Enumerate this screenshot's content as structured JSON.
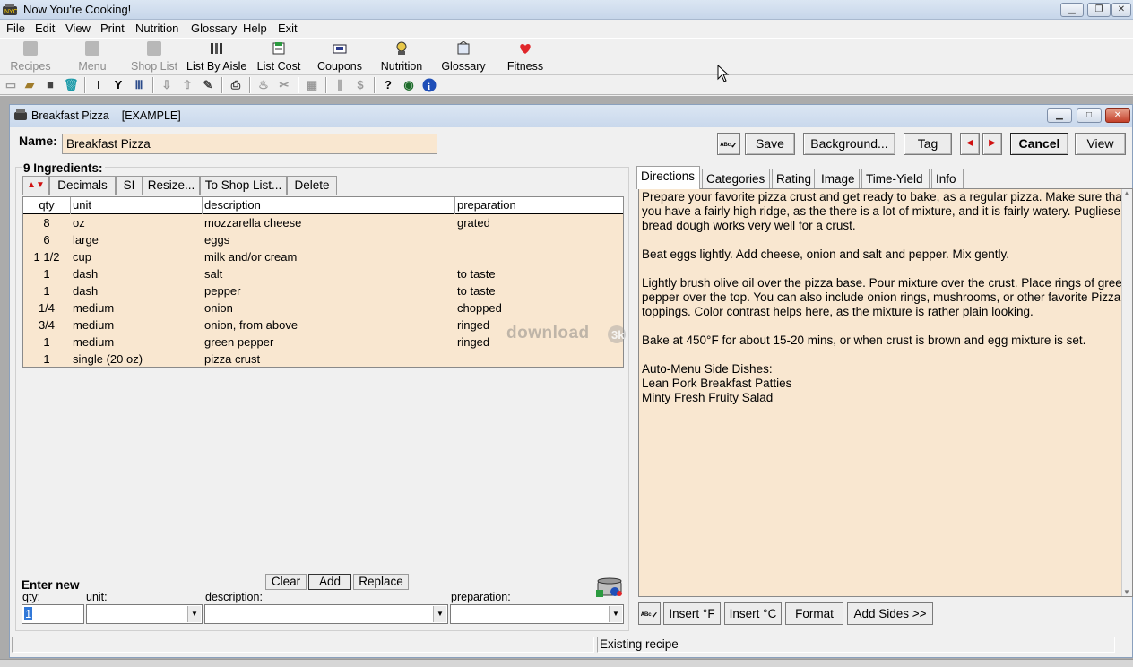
{
  "window": {
    "title": "Now You're Cooking!"
  },
  "menu": [
    "File",
    "Edit",
    "View",
    "Print",
    "Nutrition",
    "Glossary",
    "Help",
    "Exit"
  ],
  "big_toolbar": [
    {
      "label": "Recipes",
      "icon": "recipes-icon",
      "enabled": false
    },
    {
      "label": "Menu",
      "icon": "menu-icon",
      "enabled": false
    },
    {
      "label": "Shop List",
      "icon": "shop-list-icon",
      "enabled": false
    },
    {
      "label": "List By Aisle",
      "icon": "list-by-aisle-icon",
      "enabled": true
    },
    {
      "label": "List Cost",
      "icon": "list-cost-icon",
      "enabled": true
    },
    {
      "label": "Coupons",
      "icon": "coupons-icon",
      "enabled": true
    },
    {
      "label": "Nutrition",
      "icon": "nutrition-icon",
      "enabled": true
    },
    {
      "label": "Glossary",
      "icon": "glossary-icon",
      "enabled": true
    },
    {
      "label": "Fitness",
      "icon": "heart-icon",
      "enabled": true
    }
  ],
  "child": {
    "title": "Breakfast Pizza    [EXAMPLE]",
    "name_label": "Name:",
    "name_value": "Breakfast Pizza",
    "buttons": {
      "save": "Save",
      "background": "Background...",
      "tag": "Tag",
      "cancel": "Cancel",
      "view": "View"
    },
    "ingredients": {
      "count_label": "9 Ingredients:",
      "toolbar": [
        "Decimals",
        "SI",
        "Resize...",
        "To Shop List...",
        "Delete"
      ],
      "columns": [
        "qty",
        "unit",
        "description",
        "preparation"
      ],
      "rows": [
        {
          "qty": "8",
          "unit": "oz",
          "description": "mozzarella cheese",
          "preparation": "grated"
        },
        {
          "qty": "6",
          "unit": "large",
          "description": "eggs",
          "preparation": ""
        },
        {
          "qty": "1 1/2",
          "unit": "cup",
          "description": "milk and/or cream",
          "preparation": ""
        },
        {
          "qty": "1",
          "unit": "dash",
          "description": "salt",
          "preparation": "to taste"
        },
        {
          "qty": "1",
          "unit": "dash",
          "description": "pepper",
          "preparation": "to taste"
        },
        {
          "qty": "1/4",
          "unit": "medium",
          "description": "onion",
          "preparation": "chopped"
        },
        {
          "qty": "3/4",
          "unit": "medium",
          "description": "onion, from above",
          "preparation": "ringed"
        },
        {
          "qty": "1",
          "unit": "medium",
          "description": "green pepper",
          "preparation": "ringed"
        },
        {
          "qty": "1",
          "unit": "single (20 oz)",
          "description": "pizza crust",
          "preparation": ""
        }
      ]
    },
    "enter_new": {
      "label": "Enter new",
      "clear": "Clear",
      "add": "Add",
      "replace": "Replace",
      "qty_label": "qty:",
      "unit_label": "unit:",
      "description_label": "description:",
      "preparation_label": "preparation:",
      "qty_value": "1"
    },
    "tabs": [
      "Directions",
      "Categories",
      "Rating",
      "Image",
      "Time-Yield",
      "Info"
    ],
    "active_tab": "Directions",
    "directions": "Prepare your favorite pizza crust and get ready to bake, as a regular pizza. Make sure that you have a fairly high ridge, as the there is a lot of mixture, and it is fairly watery. Pugliese bread dough works very well for a crust.\n\nBeat eggs lightly. Add cheese, onion and salt and pepper. Mix gently.\n\nLightly brush olive oil over the pizza base. Pour mixture over the crust. Place rings of green pepper over the top. You can also include onion rings, mushrooms, or other favorite Pizza toppings. Color contrast helps here, as the mixture is rather plain looking.\n\nBake at 450°F for about 15-20 mins, or when crust is brown and egg mixture is set.\n\nAuto-Menu Side Dishes:\nLean Pork Breakfast Patties\nMinty Fresh Fruity Salad",
    "bottom_buttons": {
      "insert_f": "Insert °F",
      "insert_c": "Insert °C",
      "format": "Format",
      "add_sides": "Add Sides >>"
    },
    "status": "Existing recipe"
  },
  "watermark": "download",
  "colors": {
    "field_bg": "#f9e7d0",
    "mdi_bg": "#ababab",
    "chrome": "#f0f0f0"
  }
}
